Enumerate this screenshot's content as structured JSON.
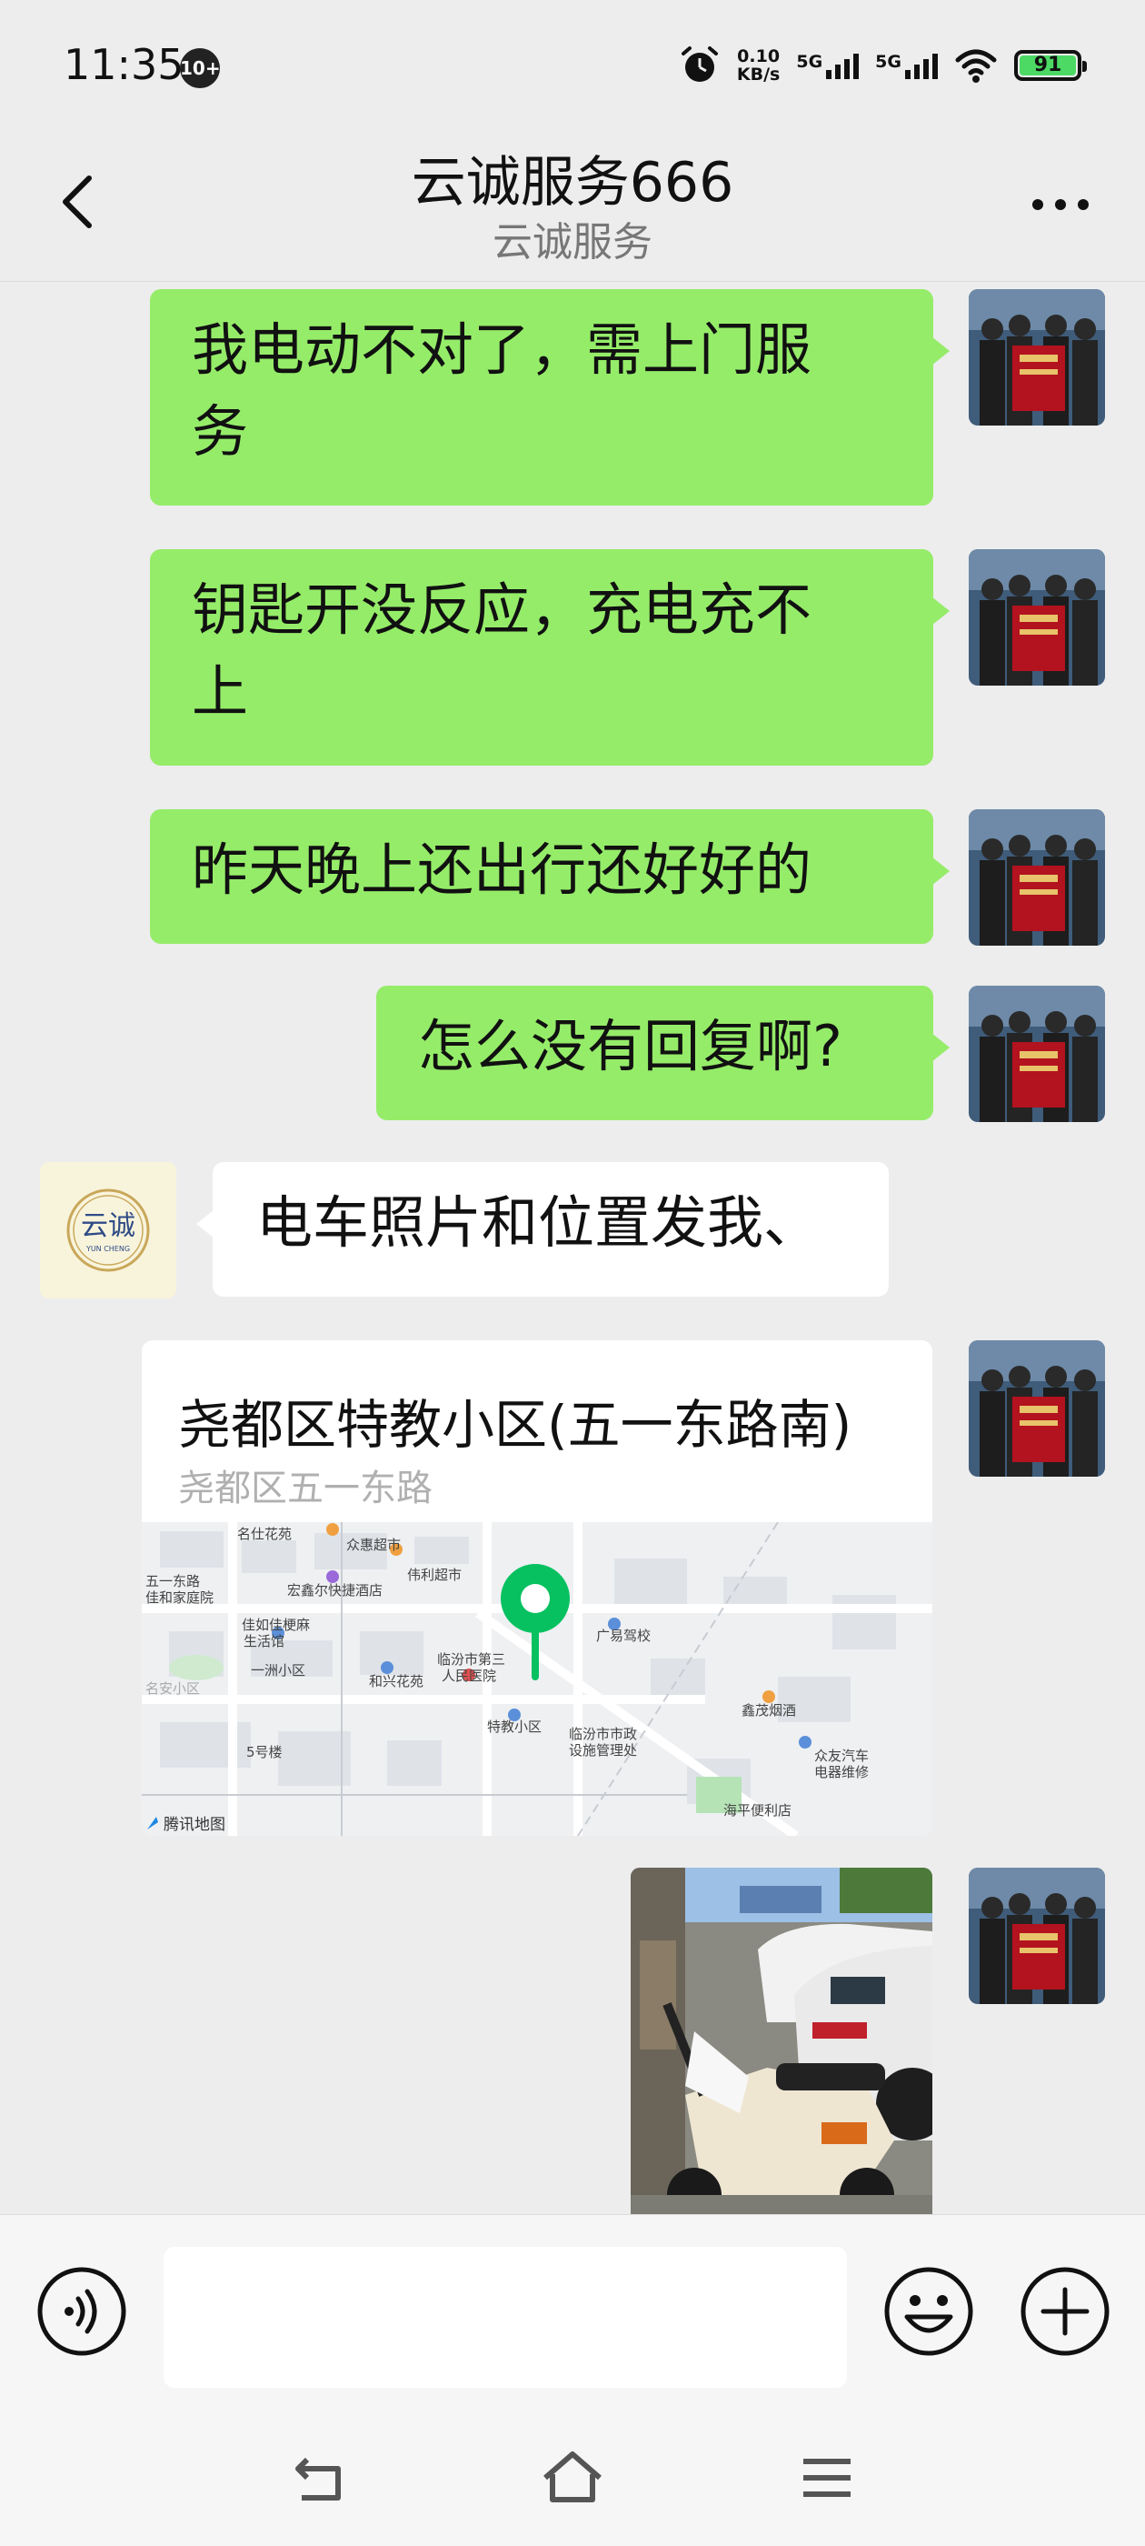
{
  "status_bar": {
    "time": "11:35",
    "notification_count": "10+",
    "net_speed_value": "0.10",
    "net_speed_unit": "KB/s",
    "signal_1": "5G",
    "signal_2": "5G",
    "battery": "91",
    "battery_color": "#4cd964"
  },
  "header": {
    "title": "云诚服务666",
    "subtitle": "云诚服务",
    "back_icon": "chevron-left-icon",
    "more_icon": "ellipsis-icon"
  },
  "messages": [
    {
      "sender": "me",
      "text_line1": "我电动不对了，需上门服",
      "text_line2": "务"
    },
    {
      "sender": "me",
      "text_line1": "钥匙开没反应，充电充不",
      "text_line2": "上"
    },
    {
      "sender": "me",
      "text": "昨天晚上还出行还好好的"
    },
    {
      "sender": "me",
      "text": "怎么没有回复啊?"
    },
    {
      "sender": "other",
      "text": "电车照片和位置发我、"
    }
  ],
  "other_avatar": {
    "logo_text": "云诚",
    "logo_sub": "YUN CHENG"
  },
  "location": {
    "title": "尧都区特教小区(五一东路南)",
    "address": "尧都区五一东路",
    "map_labels": [
      "名仕花苑",
      "众惠超市",
      "伟利超市",
      "宏鑫尔快捷酒店",
      "五一东路",
      "佳和家庭院",
      "佳如佳梗麻",
      "生活馆",
      "一洲小区",
      "和兴花苑",
      "临汾市第三",
      "人民医院",
      "特教小区",
      "临汾市市政",
      "设施管理处",
      "广易驾校",
      "鑫茂烟酒",
      "众友汽车",
      "电器维修",
      "海平便利店",
      "5号楼",
      "名安小区",
      "腾讯地图"
    ]
  },
  "colors": {
    "sent_bubble": "#95ec69",
    "received_bubble": "#ffffff",
    "background": "#ededed",
    "map_pin": "#07c160"
  },
  "input_bar": {
    "placeholder": "",
    "voice_icon": "voice-icon",
    "emoji_icon": "smile-emoji-icon",
    "plus_icon": "plus-circle-icon"
  },
  "system_nav": {
    "back_icon": "system-back-icon",
    "home_icon": "home-icon",
    "menu_icon": "menu-icon"
  }
}
